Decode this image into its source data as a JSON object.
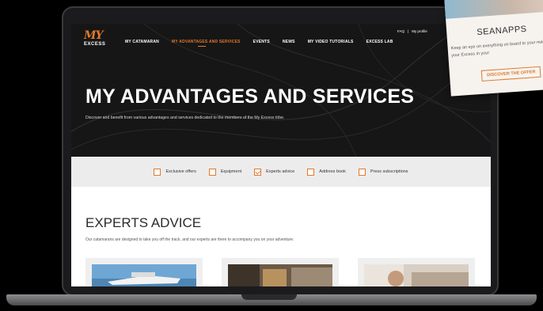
{
  "logo": {
    "my": "MY",
    "excess": "EXCESS"
  },
  "nav": {
    "items": [
      {
        "label": "MY CATAMARAN"
      },
      {
        "label": "MY ADVANTAGES AND SERVICES"
      },
      {
        "label": "EVENTS"
      },
      {
        "label": "NEWS"
      },
      {
        "label": "MY VIDEO TUTORIALS"
      },
      {
        "label": "EXCESS LAB"
      }
    ],
    "active_index": 1
  },
  "toplinks": {
    "faq": "FAQ",
    "separator": "|",
    "profile": "My profile"
  },
  "hero": {
    "title": "MY ADVANTAGES AND SERVICES",
    "subtitle": "Discover and benefit from various advantages and services dedicated to the members of the My Excess tribe."
  },
  "filters": [
    {
      "label": "Exclusive offers",
      "checked": false
    },
    {
      "label": "Equipment",
      "checked": false
    },
    {
      "label": "Experts advice",
      "checked": true
    },
    {
      "label": "Address book",
      "checked": false
    },
    {
      "label": "Press subscriptions",
      "checked": false
    }
  ],
  "section": {
    "title": "EXPERTS ADVICE",
    "text": "Our catamarans are designed to take you off the track, and our experts are there to accompany you on your adventure."
  },
  "overlay_card": {
    "title": "SEANAPPS",
    "text": "Keep an eye on everything on board to your maintenance, your Excess in your",
    "button": "DISCOVER THE OFFER"
  },
  "colors": {
    "accent": "#e0792c",
    "hero_bg": "#161616",
    "filter_bg": "#ececec"
  }
}
